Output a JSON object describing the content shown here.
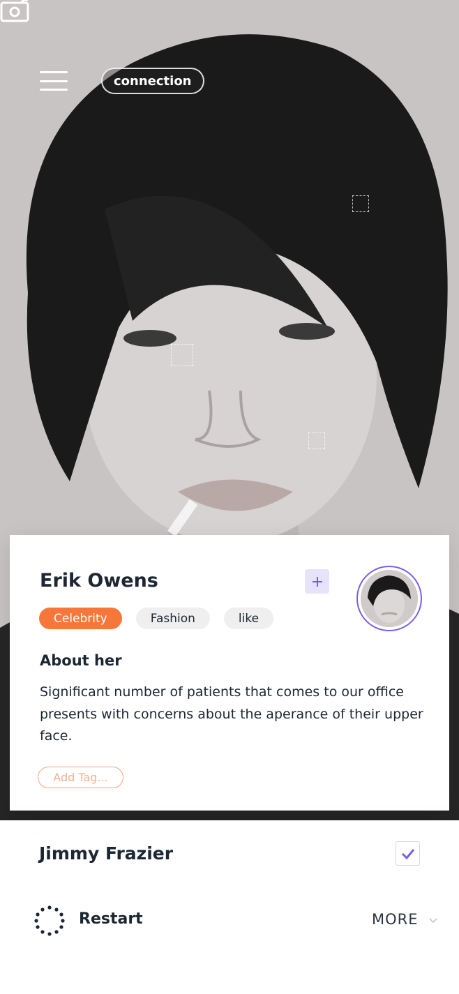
{
  "header": {
    "connection_label": "connection"
  },
  "profile": {
    "name": "Erik Owens",
    "tags": [
      "Celebrity",
      "Fashion",
      "like"
    ],
    "about_title": "About her",
    "about_text": "Significant number of patients that comes to our office presents with concerns about the aperance of their upper face.",
    "add_tag_placeholder": "Add Tag..."
  },
  "list_row": {
    "name": "Jimmy Frazier",
    "checked": true
  },
  "bottom_bar": {
    "restart_label": "Restart",
    "more_label": "MORE"
  },
  "icons": {
    "menu": "menu-icon",
    "camera": "camera-icon",
    "plus": "plus-icon",
    "check": "check-icon",
    "restart": "restart-icon",
    "chevron": "chevron-down-icon"
  },
  "colors": {
    "accent_orange": "#f7773a",
    "accent_purple": "#7b5cf0",
    "text_dark": "#1c2733"
  }
}
